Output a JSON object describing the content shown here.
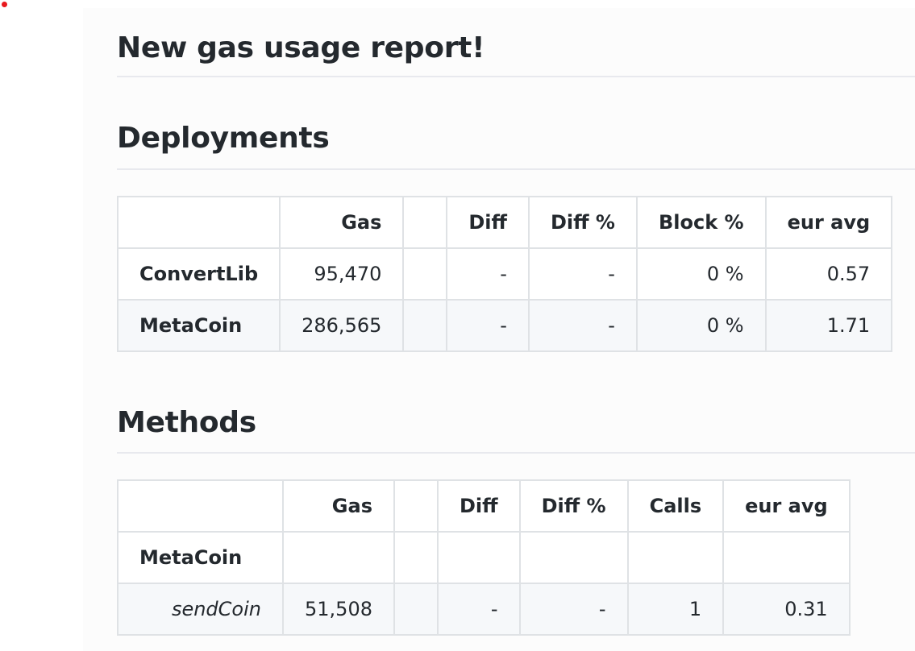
{
  "colors": {
    "text": "#24292e",
    "border": "#dfe2e5",
    "row_alt": "#f6f8fa",
    "heading_rule": "#e8e9ee",
    "panel_bg": "#fcfcfc",
    "indicator_dot": "#e8191e"
  },
  "page": {
    "title": "New gas usage report!"
  },
  "deployments": {
    "heading": "Deployments",
    "columns": [
      "",
      "Gas",
      "",
      "Diff",
      "Diff %",
      "Block %",
      "eur avg"
    ],
    "rows": [
      {
        "name": "ConvertLib",
        "gas": "95,470",
        "blank": "",
        "diff": "-",
        "diff_pct": "-",
        "block_pct": "0 %",
        "eur_avg": "0.57"
      },
      {
        "name": "MetaCoin",
        "gas": "286,565",
        "blank": "",
        "diff": "-",
        "diff_pct": "-",
        "block_pct": "0 %",
        "eur_avg": "1.71"
      }
    ]
  },
  "methods": {
    "heading": "Methods",
    "columns": [
      "",
      "Gas",
      "",
      "Diff",
      "Diff %",
      "Calls",
      "eur avg"
    ],
    "groups": [
      {
        "contract": "MetaCoin",
        "rows": [
          {
            "name": "sendCoin",
            "gas": "51,508",
            "blank": "",
            "diff": "-",
            "diff_pct": "-",
            "calls": "1",
            "eur_avg": "0.31"
          }
        ]
      }
    ]
  }
}
